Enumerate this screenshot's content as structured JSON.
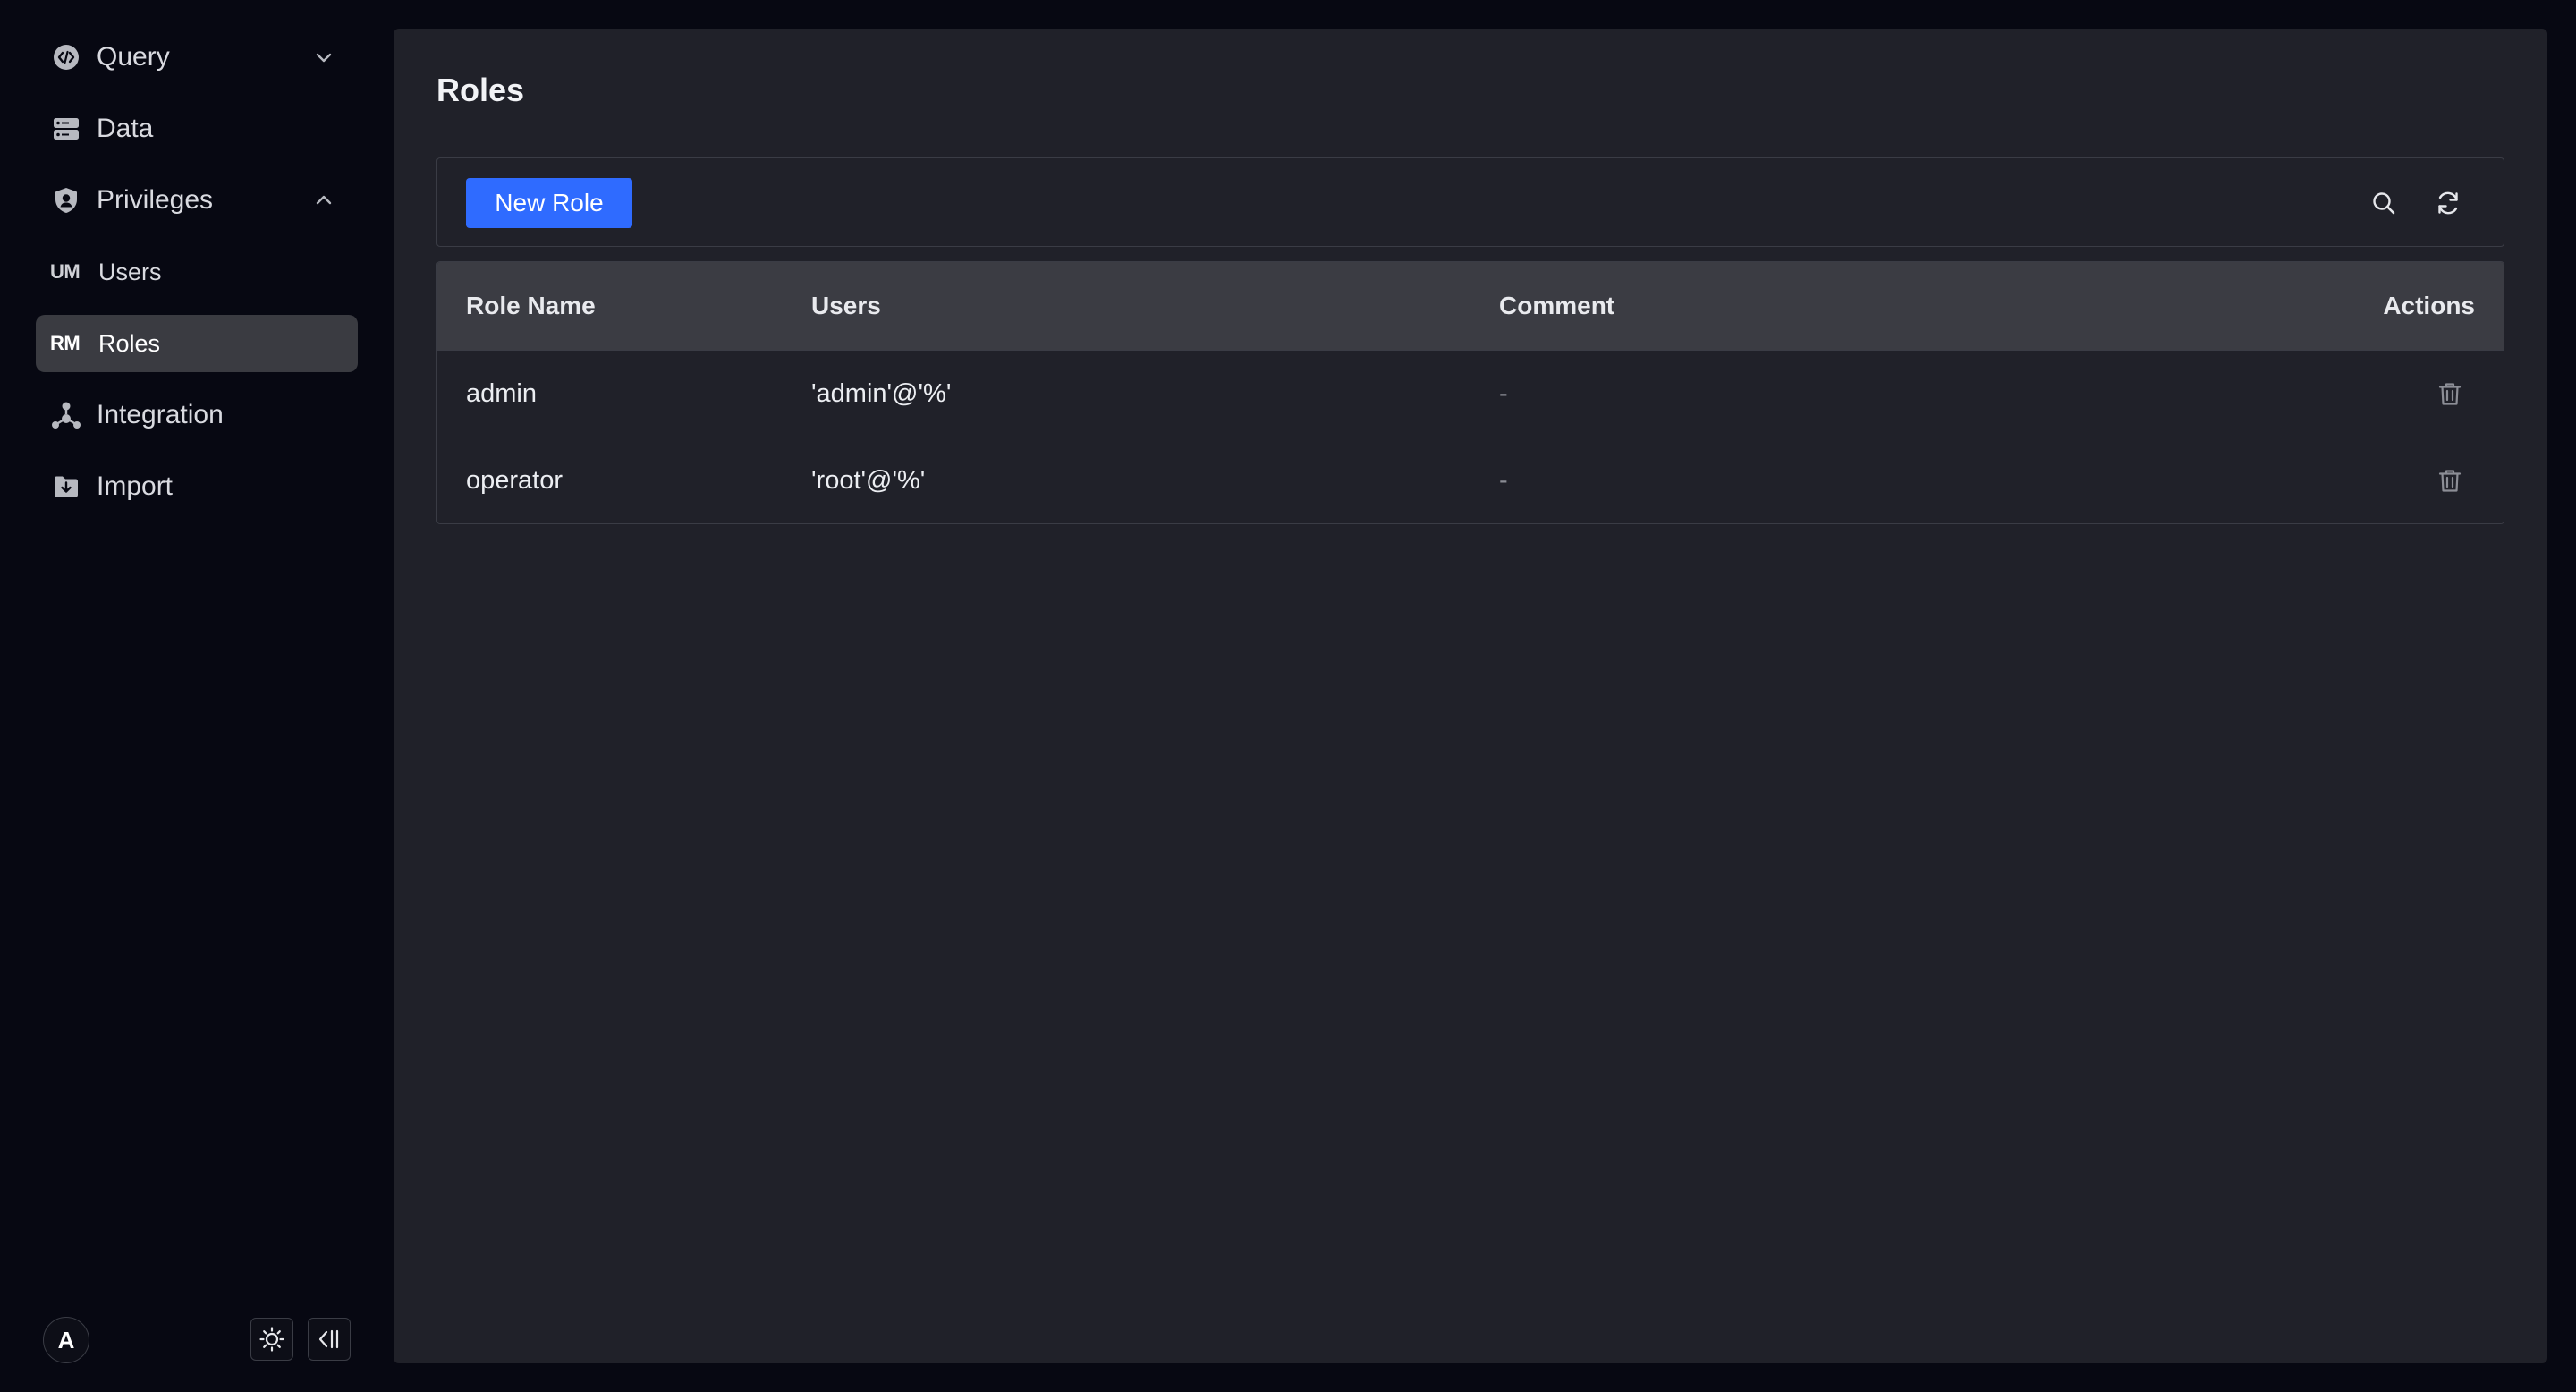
{
  "sidebar": {
    "items": [
      {
        "label": "Query",
        "icon": "code-icon",
        "expandable": "collapsed"
      },
      {
        "label": "Data",
        "icon": "database-icon"
      },
      {
        "label": "Privileges",
        "icon": "shield-user-icon",
        "expandable": "expanded"
      },
      {
        "label": "Integration",
        "icon": "integration-icon"
      },
      {
        "label": "Import",
        "icon": "import-icon"
      }
    ],
    "sub_items": [
      {
        "abbr": "UM",
        "label": "Users",
        "active": false
      },
      {
        "abbr": "RM",
        "label": "Roles",
        "active": true
      }
    ],
    "footer": {
      "avatar_letter": "A",
      "theme_icon": "sun-icon",
      "collapse_icon": "collapse-sidebar-icon"
    }
  },
  "main": {
    "title": "Roles",
    "toolbar": {
      "new_button": "New Role",
      "search_icon": "search-icon",
      "refresh_icon": "refresh-icon"
    },
    "table": {
      "columns": [
        "Role Name",
        "Users",
        "Comment",
        "Actions"
      ],
      "rows": [
        {
          "role_name": "admin",
          "users": "'admin'@'%'",
          "comment": "-",
          "action_icon": "trash-icon"
        },
        {
          "role_name": "operator",
          "users": "'root'@'%'",
          "comment": "-",
          "action_icon": "trash-icon"
        }
      ]
    }
  },
  "colors": {
    "accent": "#2f6bff",
    "background": "#070812",
    "panel": "#202129",
    "table_header": "#3b3c43"
  }
}
